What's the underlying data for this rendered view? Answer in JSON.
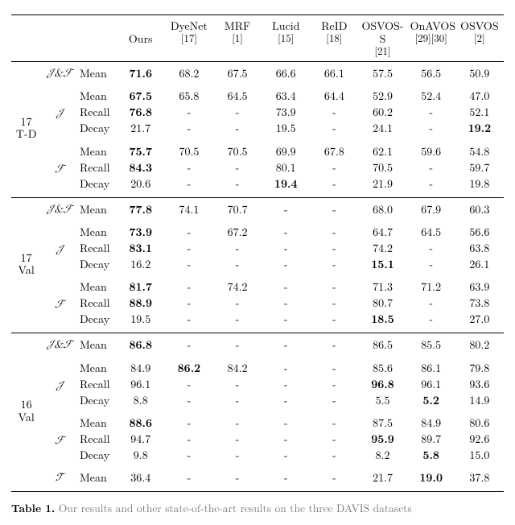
{
  "headers": {
    "ours": "Ours",
    "dyenet": "DyeNet",
    "dyenet_ref": "[17]",
    "mrf": "MRF",
    "mrf_ref": "[1]",
    "lucid": "Lucid",
    "lucid_ref": "[15]",
    "reid": "ReID",
    "reid_ref": "[18]",
    "osvoss": "OSVOS-S",
    "osvoss_ref": "[21]",
    "onavos": "OnAVOS",
    "onavos_ref": "[29][30]",
    "osvos": "OSVOS",
    "osvos_ref": "[2]"
  },
  "labels": {
    "JF": "𝒥&ℱ",
    "J": "𝒥",
    "F": "ℱ",
    "T": "𝒯",
    "mean": "Mean",
    "recall": "Recall",
    "decay": "Decay",
    "d17td_a": "17",
    "d17td_b": "T-D",
    "d17val_a": "17",
    "d17val_b": "Val",
    "d16val_a": "16",
    "d16val_b": "Val"
  },
  "caption": {
    "prefix": "Table 1.",
    "rest": " Our results and other state-of-the-art results on the three DAVIS datasets"
  },
  "blocks": [
    {
      "dataset": [
        "17",
        "T-D"
      ],
      "groups": [
        {
          "sym": "𝒥&ℱ",
          "rows": [
            {
              "stat": "Mean",
              "vals": [
                "71.6",
                "68.2",
                "67.5",
                "66.6",
                "66.1",
                "57.5",
                "56.5",
                "50.9"
              ],
              "bold": [
                0
              ]
            }
          ]
        },
        {
          "sym": "𝒥",
          "rows": [
            {
              "stat": "Mean",
              "vals": [
                "67.5",
                "65.8",
                "64.5",
                "63.4",
                "64.4",
                "52.9",
                "52.4",
                "47.0"
              ],
              "bold": [
                0
              ]
            },
            {
              "stat": "Recall",
              "vals": [
                "76.8",
                "-",
                "-",
                "73.9",
                "-",
                "60.2",
                "-",
                "52.1"
              ],
              "bold": [
                0
              ]
            },
            {
              "stat": "Decay",
              "vals": [
                "21.7",
                "-",
                "-",
                "19.5",
                "-",
                "24.1",
                "-",
                "19.2"
              ],
              "bold": [
                7
              ]
            }
          ]
        },
        {
          "sym": "ℱ",
          "rows": [
            {
              "stat": "Mean",
              "vals": [
                "75.7",
                "70.5",
                "70.5",
                "69.9",
                "67.8",
                "62.1",
                "59.6",
                "54.8"
              ],
              "bold": [
                0
              ]
            },
            {
              "stat": "Recall",
              "vals": [
                "84.3",
                "-",
                "-",
                "80.1",
                "-",
                "70.5",
                "-",
                "59.7"
              ],
              "bold": [
                0
              ]
            },
            {
              "stat": "Decay",
              "vals": [
                "20.6",
                "-",
                "-",
                "19.4",
                "-",
                "21.9",
                "-",
                "19.8"
              ],
              "bold": [
                3
              ]
            }
          ]
        }
      ]
    },
    {
      "dataset": [
        "17",
        "Val"
      ],
      "groups": [
        {
          "sym": "𝒥&ℱ",
          "rows": [
            {
              "stat": "Mean",
              "vals": [
                "77.8",
                "74.1",
                "70.7",
                "-",
                "-",
                "68.0",
                "67.9",
                "60.3"
              ],
              "bold": [
                0
              ]
            }
          ]
        },
        {
          "sym": "𝒥",
          "rows": [
            {
              "stat": "Mean",
              "vals": [
                "73.9",
                "-",
                "67.2",
                "-",
                "-",
                "64.7",
                "64.5",
                "56.6"
              ],
              "bold": [
                0
              ]
            },
            {
              "stat": "Recall",
              "vals": [
                "83.1",
                "-",
                "-",
                "-",
                "-",
                "74.2",
                "-",
                "63.8"
              ],
              "bold": [
                0
              ]
            },
            {
              "stat": "Decay",
              "vals": [
                "16.2",
                "-",
                "-",
                "-",
                "-",
                "15.1",
                "-",
                "26.1"
              ],
              "bold": [
                5
              ]
            }
          ]
        },
        {
          "sym": "ℱ",
          "rows": [
            {
              "stat": "Mean",
              "vals": [
                "81.7",
                "-",
                "74.2",
                "-",
                "-",
                "71.3",
                "71.2",
                "63.9"
              ],
              "bold": [
                0
              ]
            },
            {
              "stat": "Recall",
              "vals": [
                "88.9",
                "-",
                "-",
                "-",
                "-",
                "80.7",
                "-",
                "73.8"
              ],
              "bold": [
                0
              ]
            },
            {
              "stat": "Decay",
              "vals": [
                "19.5",
                "-",
                "-",
                "-",
                "-",
                "18.5",
                "-",
                "27.0"
              ],
              "bold": [
                5
              ]
            }
          ]
        }
      ]
    },
    {
      "dataset": [
        "16",
        "Val"
      ],
      "groups": [
        {
          "sym": "𝒥&ℱ",
          "rows": [
            {
              "stat": "Mean",
              "vals": [
                "86.8",
                "-",
                "-",
                "-",
                "-",
                "86.5",
                "85.5",
                "80.2"
              ],
              "bold": [
                0
              ]
            }
          ]
        },
        {
          "sym": "𝒥",
          "rows": [
            {
              "stat": "Mean",
              "vals": [
                "84.9",
                "86.2",
                "84.2",
                "-",
                "-",
                "85.6",
                "86.1",
                "79.8"
              ],
              "bold": [
                1
              ]
            },
            {
              "stat": "Recall",
              "vals": [
                "96.1",
                "-",
                "-",
                "-",
                "-",
                "96.8",
                "96.1",
                "93.6"
              ],
              "bold": [
                5
              ]
            },
            {
              "stat": "Decay",
              "vals": [
                "8.8",
                "-",
                "-",
                "-",
                "-",
                "5.5",
                "5.2",
                "14.9"
              ],
              "bold": [
                6
              ]
            }
          ]
        },
        {
          "sym": "ℱ",
          "rows": [
            {
              "stat": "Mean",
              "vals": [
                "88.6",
                "-",
                "-",
                "-",
                "-",
                "87.5",
                "84.9",
                "80.6"
              ],
              "bold": [
                0
              ]
            },
            {
              "stat": "Recall",
              "vals": [
                "94.7",
                "-",
                "-",
                "-",
                "-",
                "95.9",
                "89.7",
                "92.6"
              ],
              "bold": [
                5
              ]
            },
            {
              "stat": "Decay",
              "vals": [
                "9.8",
                "-",
                "-",
                "-",
                "-",
                "8.2",
                "5.8",
                "15.0"
              ],
              "bold": [
                6
              ]
            }
          ]
        },
        {
          "sym": "𝒯",
          "rows": [
            {
              "stat": "Mean",
              "vals": [
                "36.4",
                "-",
                "-",
                "-",
                "-",
                "21.7",
                "19.0",
                "37.8"
              ],
              "bold": [
                6
              ]
            }
          ]
        }
      ]
    }
  ]
}
